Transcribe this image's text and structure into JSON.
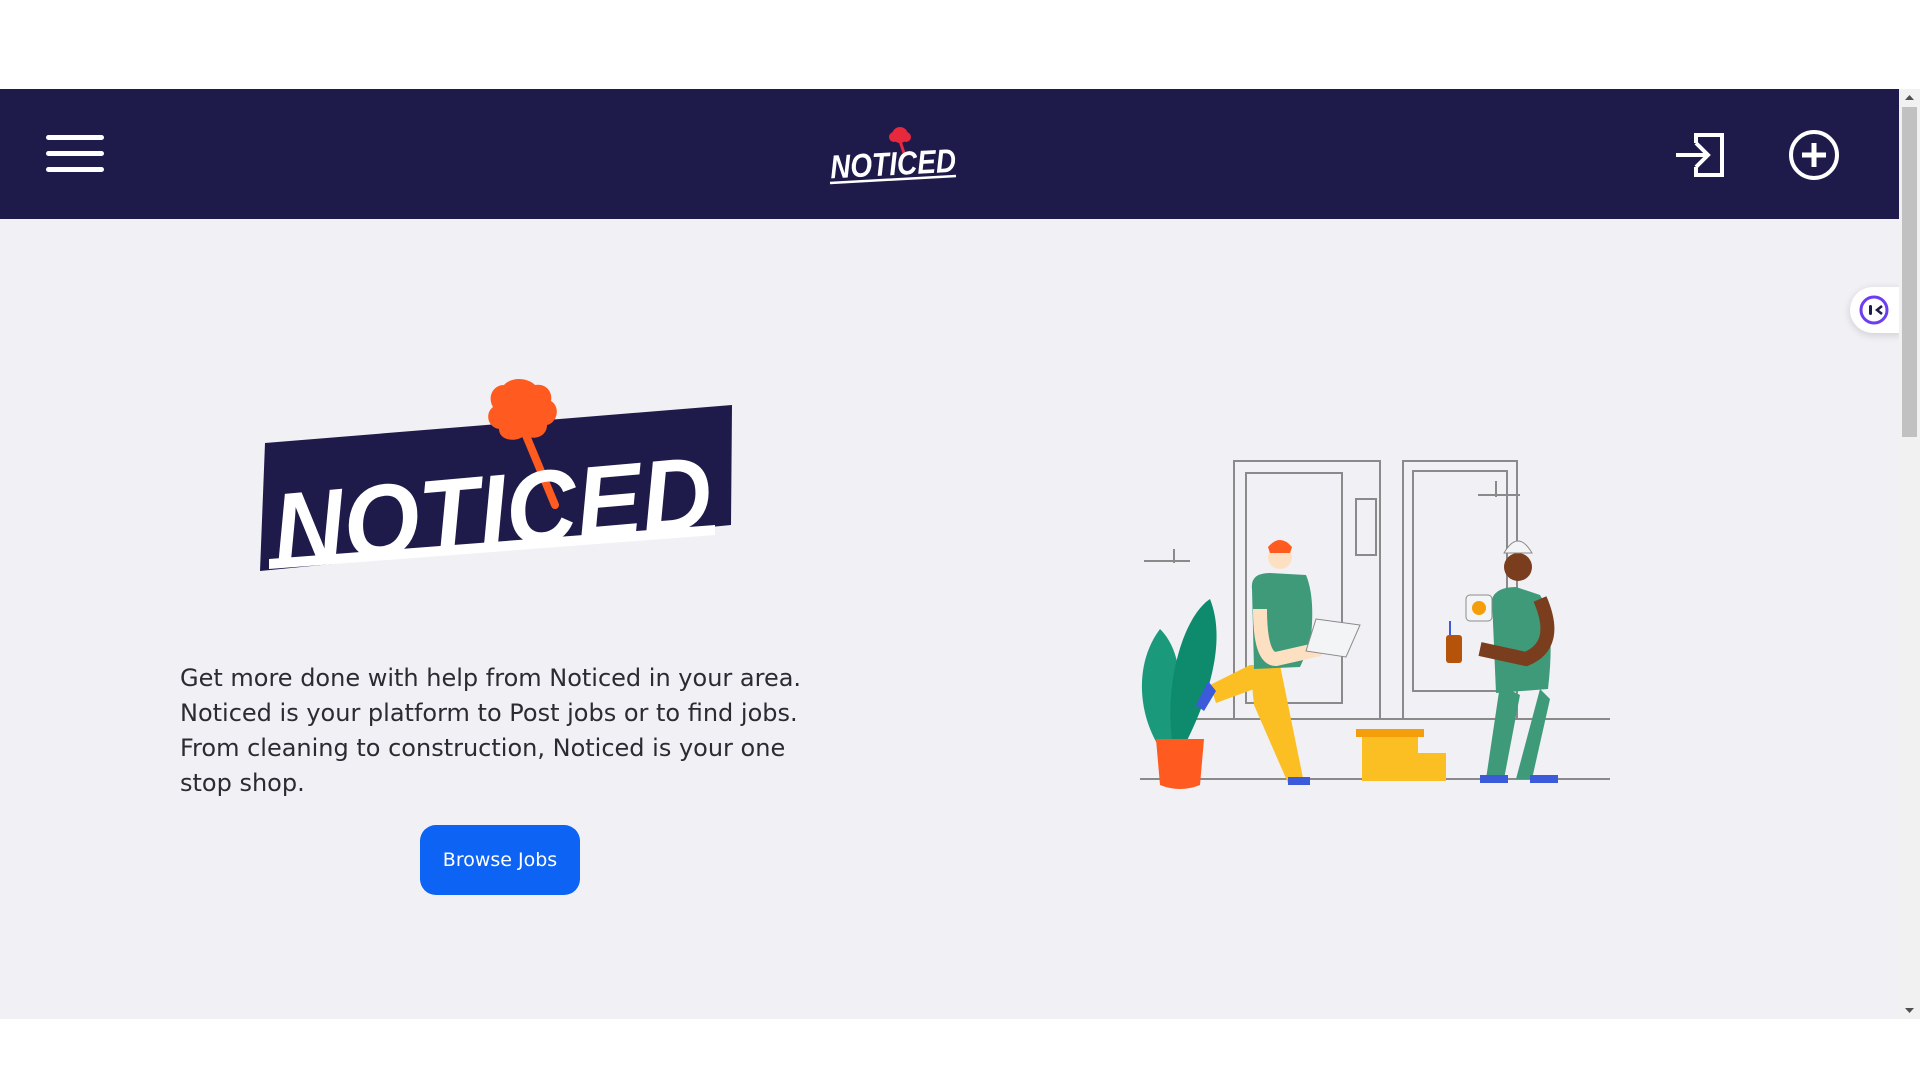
{
  "header": {
    "logo_text": "NOTICED",
    "menu_icon": "hamburger-menu-icon",
    "login_icon": "sign-in-icon",
    "add_icon": "plus-circle-icon"
  },
  "hero": {
    "logo_text": "NOTICED",
    "description": "Get more done with help from Noticed in your area. Noticed is your platform to Post jobs or to find jobs. From cleaning to construction, Noticed is your one stop shop.",
    "button_label": "Browse Jobs"
  },
  "colors": {
    "navbar": "#1e1b4b",
    "page_background": "#f1f0f5",
    "button": "#0d63f3",
    "logo_pin": "#ff5a1f"
  }
}
